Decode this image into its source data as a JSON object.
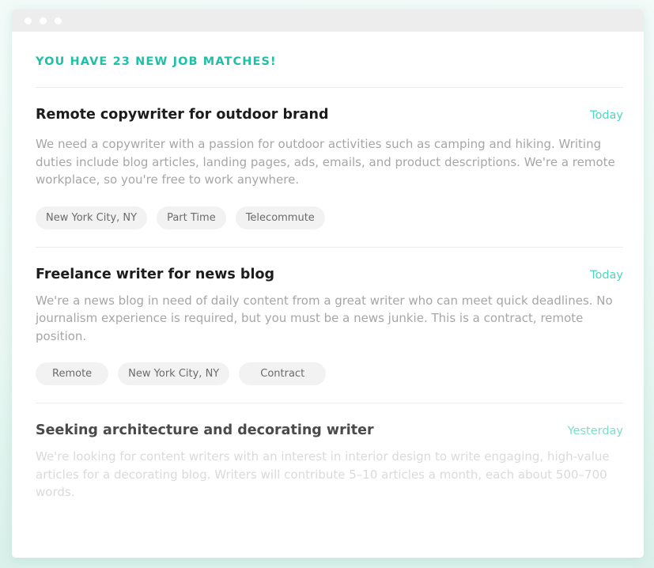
{
  "window": {
    "dots": 3
  },
  "headline": "YOU HAVE 23 NEW JOB MATCHES!",
  "jobs": [
    {
      "title": "Remote copywriter for outdoor brand",
      "date": "Today",
      "description": "We need a copywriter with a passion for outdoor activities such as camping and hiking. Writing duties include blog articles, landing pages, ads, emails, and product descriptions. We're a remote workplace, so you're free to work anywhere.",
      "tags": [
        "New York City, NY",
        "Part Time",
        "Telecommute"
      ]
    },
    {
      "title": "Freelance writer for news blog",
      "date": "Today",
      "description": "We're a news blog in need of daily content from a great writer who can meet quick deadlines. No journalism experience is required, but you must be a news junkie. This is a contract, remote position.",
      "tags": [
        "Remote",
        "New York City, NY",
        "Contract"
      ]
    },
    {
      "title": "Seeking architecture and decorating writer",
      "date": "Yesterday",
      "description": "We're looking for content writers with an interest in interior design to write engaging, high-value articles for a decorating blog. Writers will contribute 5–10 articles a month, each about 500–700 words.",
      "tags": []
    }
  ],
  "colors": {
    "accent": "#1fbfa8",
    "date": "#4fd6bf",
    "tag_bg": "#f2f2f2"
  }
}
